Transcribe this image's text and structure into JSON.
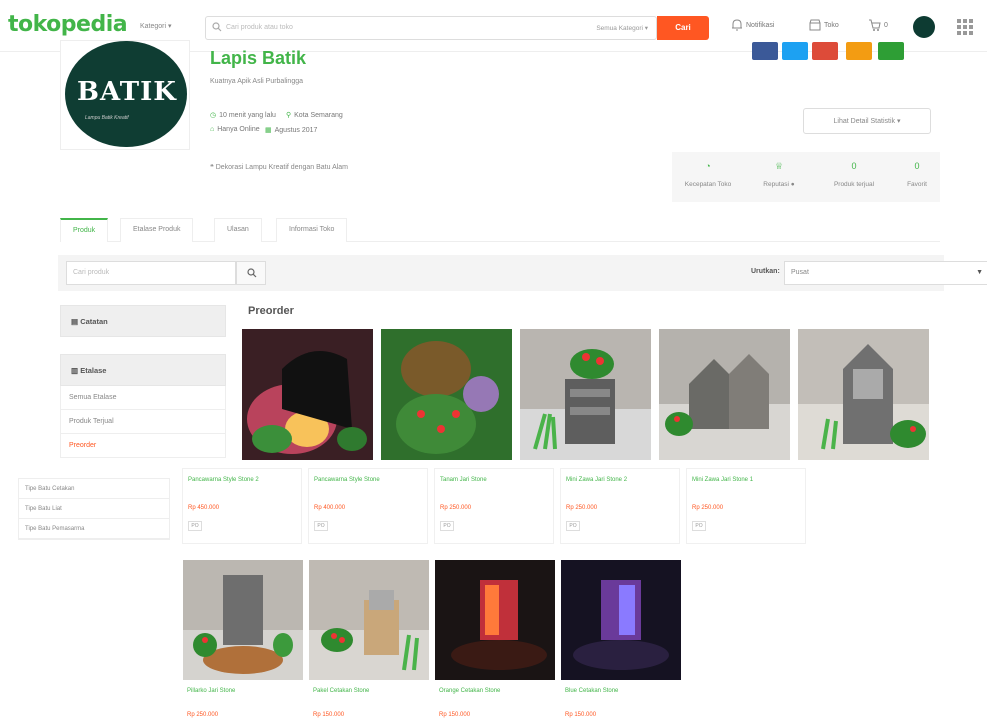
{
  "header": {
    "logo": "tokopedia",
    "kategori": "Kategori ▾",
    "search_placeholder": "Cari produk atau toko",
    "search_category": "Semua Kategori ▾",
    "search_button": "Cari",
    "notif": "Notifikasi",
    "toko": "Toko",
    "cart_count": "0",
    "accent": "#42b549",
    "cta": "#ff5722"
  },
  "shop": {
    "logo_text": "BATIK",
    "logo_tagline": "Lampu Batik Kreatif",
    "name": "Lapis Batik",
    "tagline": "Kuatnya Apik Asli Purbalingga",
    "last_online": "10 menit yang lalu",
    "city": "Kota Semarang",
    "online_only": "Hanya Online",
    "since": "Agustus 2017",
    "quote": "Dekorasi Lampu Kreatif dengan Batu Alam",
    "detail_button": "Lihat Detail Statistik ▾"
  },
  "stats": [
    {
      "value": "",
      "label": "Kecepatan Toko"
    },
    {
      "value": "",
      "label": "Reputasi"
    },
    {
      "value": "0",
      "label": "Produk terjual"
    },
    {
      "value": "0",
      "label": "Favorit"
    }
  ],
  "tabs": [
    "Produk",
    "Etalase Produk",
    "Ulasan",
    "Informasi Toko"
  ],
  "product_search": {
    "placeholder": "Cari produk",
    "sort_label": "Urutkan:",
    "sort_value": "Pusat"
  },
  "sidebar": {
    "catatan": "Catatan",
    "etalase": "Etalase",
    "items": [
      "Semua Etalase",
      "Produk Terjual",
      "Preorder"
    ],
    "sub_items": [
      "Tipe Batu Cetakan",
      "Tipe Batu Liat",
      "Tipe Batu Pemasarma"
    ]
  },
  "section": {
    "title": "Preorder"
  },
  "products_row1": [
    {
      "name": "Pancawarna Style Stone 2",
      "price": "Rp 450.000",
      "badge": "PO"
    },
    {
      "name": "Pancawarna Style Stone",
      "price": "Rp 400.000",
      "badge": "PO"
    },
    {
      "name": "Tanam Jari Stone",
      "price": "Rp 250.000",
      "badge": "PO"
    },
    {
      "name": "Mini Zawa Jari Stone 2",
      "price": "Rp 250.000",
      "badge": "PO"
    },
    {
      "name": "Mini Zawa Jari Stone 1",
      "price": "Rp 250.000",
      "badge": "PO"
    }
  ],
  "products_row2": [
    {
      "name": "Pillarko Jari Stone",
      "price": "Rp 250.000"
    },
    {
      "name": "Pakel Cetakan Stone",
      "price": "Rp 150.000"
    },
    {
      "name": "Orange Cetakan Stone",
      "price": "Rp 150.000"
    },
    {
      "name": "Blue Cetakan Stone",
      "price": "Rp 150.000"
    }
  ]
}
